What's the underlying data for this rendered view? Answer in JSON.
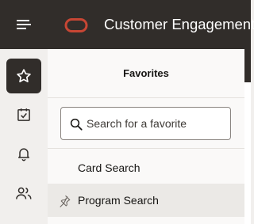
{
  "app": {
    "title": "Customer Engagement"
  },
  "icons": {
    "menu": "hamburger-menu-icon",
    "logo": "oracle-logo",
    "favorites": "star-icon",
    "calendar": "calendar-check-icon",
    "notifications": "bell-icon",
    "contacts": "people-icon",
    "search": "search-icon",
    "pin": "pin-icon"
  },
  "colors": {
    "topbar": "#312d2a",
    "brand_red": "#c74634",
    "panel_bg": "#faf9f8",
    "rail_bg": "#f1efed"
  },
  "panel": {
    "title": "Favorites",
    "search_placeholder": "Search for a favorite",
    "items": [
      {
        "label": "Card Search"
      },
      {
        "label": "Program Search"
      }
    ]
  }
}
